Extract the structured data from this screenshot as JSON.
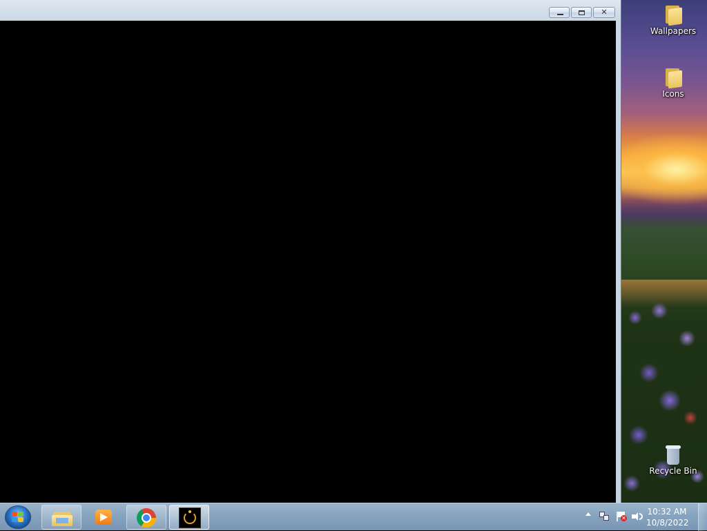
{
  "desktop": {
    "icons": [
      {
        "label": "Wallpapers",
        "icon": "folder-icon"
      },
      {
        "label": "Icons",
        "icon": "folder-icon"
      },
      {
        "label": "Recycle Bin",
        "icon": "recycle-bin-icon"
      }
    ]
  },
  "window": {
    "title": "",
    "client_color": "#000000",
    "controls": {
      "minimize": "minimize-icon",
      "maximize": "restore-icon",
      "close": "close-icon"
    }
  },
  "taskbar": {
    "start": "windows-start-icon",
    "items": [
      {
        "name": "Windows Explorer",
        "icon": "file-explorer-icon",
        "state": "pinned"
      },
      {
        "name": "Windows Media Player",
        "icon": "media-player-icon",
        "state": "pinned"
      },
      {
        "name": "Google Chrome",
        "icon": "chrome-icon",
        "state": "pinned"
      },
      {
        "name": "Application",
        "icon": "app-icon",
        "state": "active"
      }
    ],
    "tray": {
      "icons": [
        "show-hidden-icons-icon",
        "network-icon",
        "action-center-icon",
        "volume-icon"
      ],
      "time": "10:32 AM",
      "date": "10/8/2022"
    }
  }
}
